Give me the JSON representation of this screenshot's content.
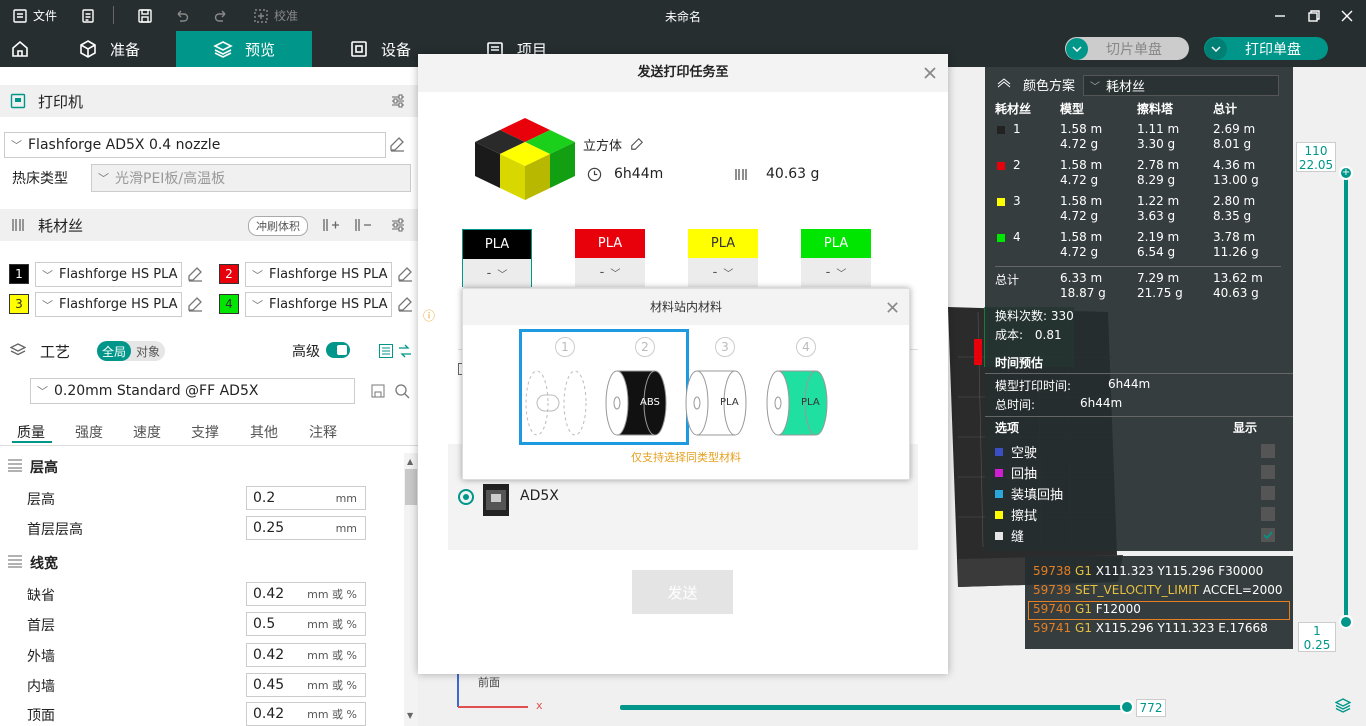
{
  "titlebar": {
    "file_label": "文件",
    "calibrate_label": "校准",
    "window_title": "未命名"
  },
  "tabs": {
    "prepare": "准备",
    "preview": "预览",
    "device": "设备",
    "project": "项目"
  },
  "actions": {
    "slice_label": "切片单盘",
    "print_label": "打印单盘"
  },
  "printer": {
    "section": "打印机",
    "name": "Flashforge AD5X 0.4 nozzle",
    "bed_label": "热床类型",
    "bed_value": "光滑PEI板/高温板"
  },
  "filament": {
    "section": "耗材丝",
    "flush_label": "冲刷体积",
    "slots": [
      {
        "num": "1",
        "name": "Flashforge HS PLA",
        "color": "#000000"
      },
      {
        "num": "2",
        "name": "Flashforge HS PLA",
        "color": "#e8000b"
      },
      {
        "num": "3",
        "name": "Flashforge HS PLA",
        "color": "#ffff00"
      },
      {
        "num": "4",
        "name": "Flashforge HS PLA",
        "color": "#00e600"
      }
    ]
  },
  "process": {
    "section": "工艺",
    "toggle_global": "全局",
    "toggle_object": "对象",
    "advanced_label": "高级",
    "preset": "0.20mm Standard @FF AD5X"
  },
  "subtabs": [
    "质量",
    "强度",
    "速度",
    "支撑",
    "其他",
    "注释"
  ],
  "quality": {
    "layer_group": "层高",
    "layer_height_label": "层高",
    "layer_height": "0.2",
    "first_layer_label": "首层层高",
    "first_layer": "0.25",
    "unit_mm": "mm",
    "width_group": "线宽",
    "unit_mm_pct": "mm 或 %",
    "widths": [
      {
        "label": "缺省",
        "value": "0.42"
      },
      {
        "label": "首层",
        "value": "0.5"
      },
      {
        "label": "外墙",
        "value": "0.42"
      },
      {
        "label": "内墙",
        "value": "0.45"
      },
      {
        "label": "顶面",
        "value": "0.42"
      }
    ]
  },
  "stats": {
    "scheme_label": "颜色方案",
    "scheme_value": "耗材丝",
    "headers": [
      "耗材丝",
      "模型",
      "擦料塔",
      "总计"
    ],
    "rows": [
      {
        "id": "1",
        "color": "#222222",
        "model": [
          "1.58 m",
          "4.72 g"
        ],
        "tower": [
          "1.11 m",
          "3.30 g"
        ],
        "total": [
          "2.69 m",
          "8.01 g"
        ]
      },
      {
        "id": "2",
        "color": "#e8000b",
        "model": [
          "1.58 m",
          "4.72 g"
        ],
        "tower": [
          "2.78 m",
          "8.29 g"
        ],
        "total": [
          "4.36 m",
          "13.00 g"
        ]
      },
      {
        "id": "3",
        "color": "#ffff00",
        "model": [
          "1.58 m",
          "4.72 g"
        ],
        "tower": [
          "1.22 m",
          "3.63 g"
        ],
        "total": [
          "2.80 m",
          "8.35 g"
        ]
      },
      {
        "id": "4",
        "color": "#00e600",
        "model": [
          "1.58 m",
          "4.72 g"
        ],
        "tower": [
          "2.19 m",
          "6.54 g"
        ],
        "total": [
          "3.78 m",
          "11.26 g"
        ]
      }
    ],
    "sum_label": "总计",
    "sum_model": [
      "6.33 m",
      "18.87 g"
    ],
    "sum_tower": [
      "7.29 m",
      "21.75 g"
    ],
    "sum_total": [
      "13.62 m",
      "40.63 g"
    ],
    "changes_label": "换料次数:",
    "changes_value": "330",
    "cost_label": "成本:",
    "cost_value": "0.81",
    "time_section": "时间预估",
    "model_time_label": "模型打印时间:",
    "model_time": "6h44m",
    "total_time_label": "总时间:",
    "total_time": "6h44m",
    "options_label": "选项",
    "show_label": "显示",
    "options": [
      {
        "label": "空驶",
        "color": "#3a4fc4"
      },
      {
        "label": "回抽",
        "color": "#d21ed2"
      },
      {
        "label": "装填回抽",
        "color": "#2aa7d8"
      },
      {
        "label": "擦拭",
        "color": "#ffff00"
      },
      {
        "label": "缝",
        "color": "#e6e6e6"
      }
    ]
  },
  "layers": {
    "top_value": "110",
    "top_height": "22.05",
    "bottom_value": "1",
    "bottom_height": "0.25",
    "move_value": "772"
  },
  "gcode": [
    {
      "line": "59738",
      "cmd": "G1",
      "args": "X111.323 Y115.296 F30000"
    },
    {
      "line": "59739",
      "cmd": "SET_VELOCITY_LIMIT",
      "args": "ACCEL=2000"
    },
    {
      "line": "59740",
      "cmd": "G1",
      "args": "F12000"
    },
    {
      "line": "59741",
      "cmd": "G1",
      "args": "X115.296 Y111.323 E.17668"
    }
  ],
  "viewport": {
    "front_label": "前面",
    "x_axis": "x"
  },
  "dialog": {
    "title": "发送打印任务至",
    "model_name": "立方体",
    "time": "6h44m",
    "weight": "40.63 g",
    "filaments": [
      {
        "name": "PLA",
        "color": "#000000",
        "text": "#ffffff",
        "sel": "-"
      },
      {
        "name": "PLA",
        "color": "#e8000b",
        "text": "#ffffff",
        "sel": "-"
      },
      {
        "name": "PLA",
        "color": "#ffff00",
        "text": "#333333",
        "sel": "-"
      },
      {
        "name": "PLA",
        "color": "#00e600",
        "text": "#ffffff",
        "sel": "-"
      }
    ],
    "device_name": "AD5X",
    "send_label": "发送"
  },
  "station": {
    "title": "材料站内材料",
    "slots": [
      "1",
      "2",
      "3",
      "4"
    ],
    "spool_labels": [
      "",
      "ABS",
      "PLA",
      "PLA"
    ],
    "note": "仅支持选择同类型材料"
  }
}
